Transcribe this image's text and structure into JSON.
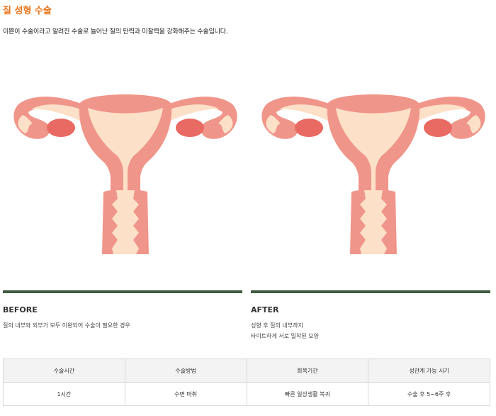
{
  "header": {
    "title": "질 성형 수술",
    "description": "이쁜이 수술이라고 알려진 수술로 늘어난 질의 탄력과 미찰력을 강화해주는 수술입니다."
  },
  "comparison": {
    "before": {
      "heading": "BEFORE",
      "lines": [
        "질의 내부와 외부가 모두 이완되어 수술이 필요한 경우"
      ]
    },
    "after": {
      "heading": "AFTER",
      "lines": [
        "성형 후 질의 내부까지",
        "타이트하게 서로 밀착된 모양"
      ]
    }
  },
  "colors": {
    "accent": "#e8741a",
    "divider": "#3e5a40",
    "organ_outer": "#f0958a",
    "organ_inner": "#fde0c8",
    "ovary": "#e86a63"
  },
  "info_table": {
    "headers": [
      "수술시간",
      "수술방법",
      "회복기간",
      "성관계 가능 시기"
    ],
    "values": [
      "1시간",
      "수면 마취",
      "빠른 일상생활 복귀",
      "수술 후 5~6주 후"
    ]
  }
}
